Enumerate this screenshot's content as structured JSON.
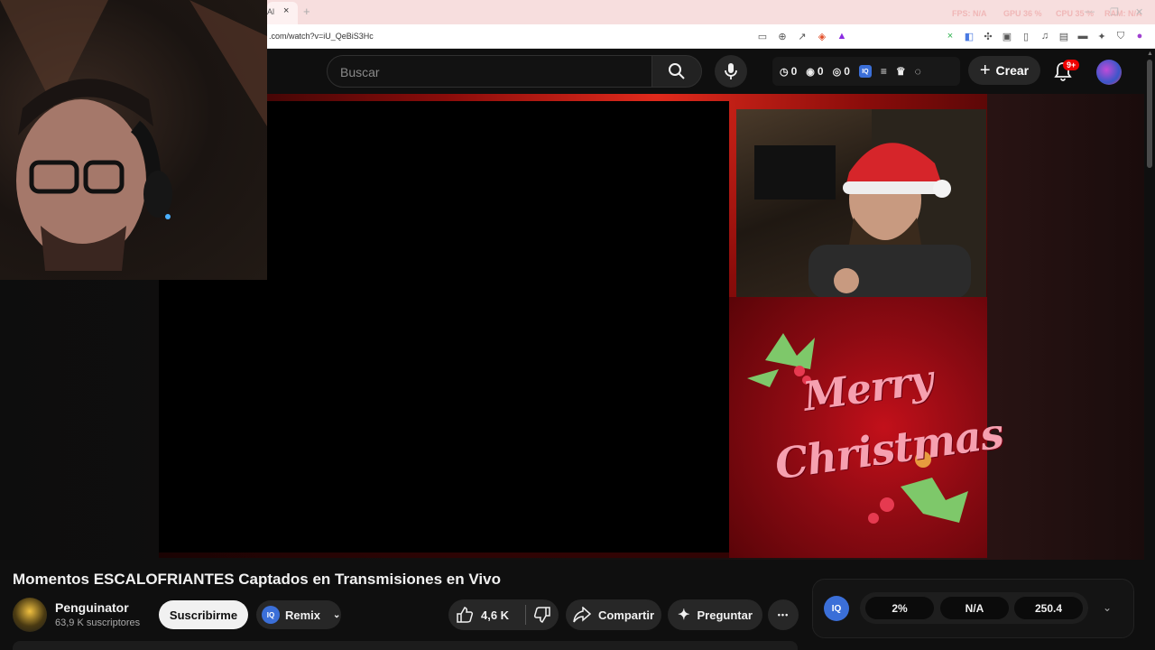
{
  "browser": {
    "tab_title": "Al",
    "tab_close": "×",
    "new_tab": "+",
    "url": ".com/watch?v=iU_QeBiS3Hc",
    "overlay": {
      "fps_label": "FPS: N/A",
      "gpu_label": "GPU 36 %",
      "cpu_label": "CPU 35 %",
      "extra_label": "RAM: N/A"
    }
  },
  "masthead": {
    "search_placeholder": "Buscar",
    "stats": {
      "watch_count": "0",
      "view_count": "0",
      "eye_count": "0",
      "iq_label": "IQ"
    },
    "create_label": "Crear",
    "notifications_badge": "9+"
  },
  "video": {
    "card_line1": "Merry",
    "card_line2": "Christmas"
  },
  "info": {
    "title": "Momentos ESCALOFRIANTES Captados en Transmisiones en Vivo",
    "channel_name": "Penguinator",
    "channel_subs": "63,9 K suscriptores",
    "subscribe_label": "Suscribirme",
    "remix_label": "Remix",
    "remix_iq": "IQ",
    "like_count": "4,6 K",
    "share_label": "Compartir",
    "ask_label": "Preguntar",
    "more_label": "•••"
  },
  "iq_panel": {
    "logo": "IQ",
    "metric1": "2%",
    "metric2": "N/A",
    "metric3": "250.4"
  },
  "colors": {
    "accent_blue": "#3b6fd8",
    "notification_red": "#e00000",
    "background": "#0f0f0f"
  }
}
